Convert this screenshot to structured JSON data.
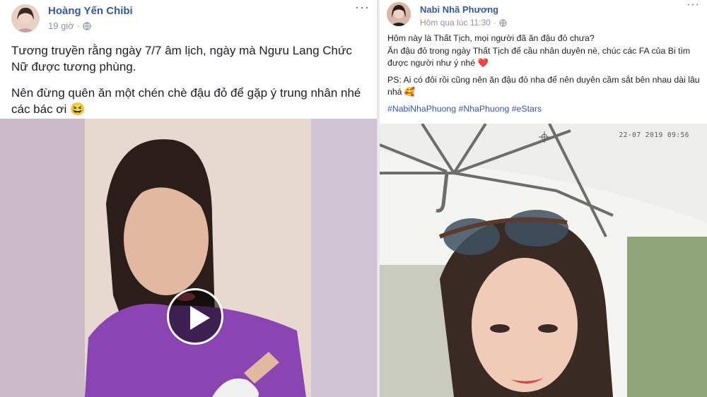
{
  "left_post": {
    "author": "Hoàng Yến Chibi",
    "time": "19 giờ",
    "privacy_icon": "globe-icon",
    "menu_icon": "more-horizontal-icon",
    "paragraphs": [
      "Tương truyền rằng ngày 7/7 âm lịch, ngày mà Ngưu Lang Chức Nữ được tương phùng.",
      "Nên đừng quên ăn một chén chè đậu đỏ để gặp ý trung nhân nhé các bác ơi 😆"
    ],
    "media_icon": "play-icon"
  },
  "right_post": {
    "author": "Nabi Nhã Phương",
    "time": "Hôm qua lúc 11:30",
    "privacy_icon": "globe-icon",
    "menu_icon": "more-horizontal-icon",
    "paragraphs": [
      "Hôm này là Thất Tịch, mọi người đã ăn đậu đỏ chưa?",
      "Ăn đậu đỏ trong ngày Thất Tịch để cầu nhân duyên nè, chúc các FA của Bi tìm được người như ý nhé ❤️",
      "PS: Ai có đôi rồi cũng nên ăn đậu đỏ nha để nên duyên cầm sắt bên nhau dài lâu nhá 🥰"
    ],
    "hashtags": "#NabiNhaPhuong #NhaPhuong #eStars",
    "photo_timestamp": "22-07 2019 09:56"
  },
  "colors": {
    "link_blue": "#385898",
    "meta_gray": "#90949c",
    "page_bg": "#e9ebee"
  }
}
